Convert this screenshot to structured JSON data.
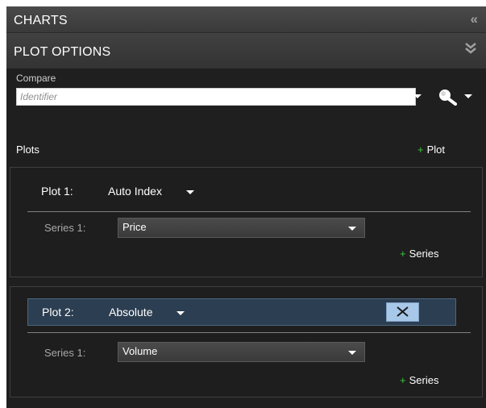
{
  "panel": {
    "charts_title": "CHARTS",
    "plot_options_title": "PLOT OPTIONS",
    "compare": {
      "label": "Compare",
      "placeholder": "Identifier"
    },
    "plots_label": "Plots",
    "add_plot_label": "Plot"
  },
  "plots": [
    {
      "label": "Plot 1:",
      "type": "Auto Index",
      "series_label": "Series 1:",
      "series_value": "Price",
      "add_series_label": "Series",
      "selected": false
    },
    {
      "label": "Plot 2:",
      "type": "Absolute",
      "series_label": "Series 1:",
      "series_value": "Volume",
      "add_series_label": "Series",
      "selected": true
    }
  ],
  "icons": {
    "collapse": "double-chevron-left-icon",
    "expand": "double-chevron-down-icon",
    "search": "magnifier-icon",
    "close": "close-x-icon"
  },
  "colors": {
    "panel_bg": "#1f1f1f",
    "header_bg": "#3a3a3a",
    "selected_row_bg": "#2c3e51",
    "plus_green": "#3ec13e",
    "close_button": "#a8c8ea"
  }
}
